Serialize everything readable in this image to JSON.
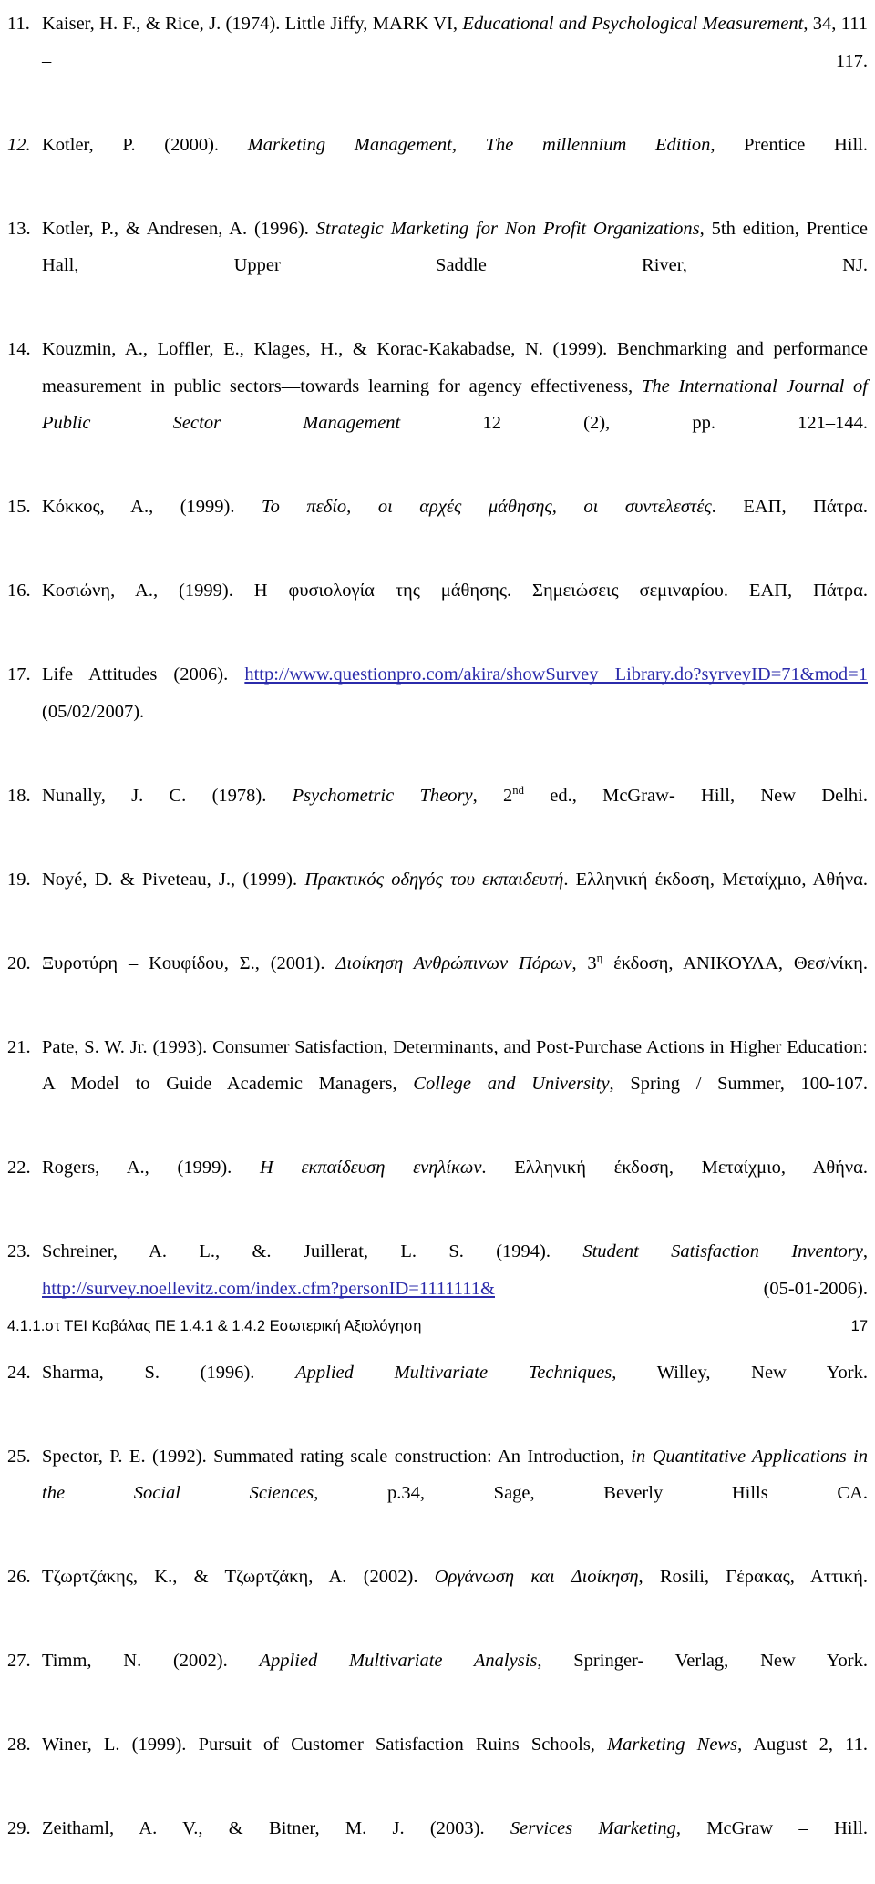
{
  "document": {
    "type": "reference-list",
    "page_number": "17",
    "footer_note": "4.1.1.στ ΤΕΙ Καβάλας ΠΕ 1.4.1 & 1.4.2 Εσωτερική Αξιολόγηση",
    "link_color": "#2b2bab",
    "text_color": "#000000",
    "background_color": "#ffffff"
  },
  "references": [
    {
      "number": "11.",
      "parts": [
        {
          "text": "Kaiser, H. F., & Rice, J. (1974). Little Jiffy, MARK VI, ",
          "style": "normal"
        },
        {
          "text": "Educational and Psychological Measurement",
          "style": "italic"
        },
        {
          "text": ", 34, 111 – 117.",
          "style": "normal"
        }
      ]
    },
    {
      "number": "12.",
      "number_style": "italic",
      "parts": [
        {
          "text": "Kotler, P. (2000). ",
          "style": "normal"
        },
        {
          "text": "Marketing Management, The millennium Edition",
          "style": "italic"
        },
        {
          "text": ", Prentice Hill.",
          "style": "normal"
        }
      ]
    },
    {
      "number": "13.",
      "parts": [
        {
          "text": "Kotler, P., & Andresen, A. (1996). ",
          "style": "normal"
        },
        {
          "text": "Strategic Marketing for Non Profit Organizations",
          "style": "italic"
        },
        {
          "text": ", 5th edition, Prentice Hall, Upper Saddle River, NJ.",
          "style": "normal"
        }
      ]
    },
    {
      "number": "14.",
      "parts": [
        {
          "text": "Kouzmin, A., Loffler, E., Klages, H., & Korac-Kakabadse, N. (1999). Benchmarking and performance measurement in public sectors—towards learning for agency effectiveness, ",
          "style": "normal"
        },
        {
          "text": "The International Journal of Public Sector Management",
          "style": "italic"
        },
        {
          "text": " 12 (2), pp. 121–144.",
          "style": "normal"
        }
      ]
    },
    {
      "number": "15.",
      "parts": [
        {
          "text": "Κόκκος, Α., (1999). ",
          "style": "normal"
        },
        {
          "text": "Το πεδίο, οι αρχές μάθησης, οι συντελεστές",
          "style": "italic"
        },
        {
          "text": ". ΕΑΠ, Πάτρα.",
          "style": "normal"
        }
      ]
    },
    {
      "number": "16.",
      "parts": [
        {
          "text": "Κοσιώνη, Α., (1999). Η φυσιολογία της μάθησης. Σημειώσεις σεμιναρίου. ΕΑΠ, Πάτρα.",
          "style": "normal"
        }
      ]
    },
    {
      "number": "17.",
      "parts": [
        {
          "text": "Life Attitudes (2006). ",
          "style": "normal"
        },
        {
          "text": "http://www.questionpro.com/akira/showSurvey Library.do?syrveyID=71&mod=1",
          "style": "link"
        },
        {
          "text": " (05/02/2007).",
          "style": "normal"
        }
      ]
    },
    {
      "number": "18.",
      "parts": [
        {
          "text": "Nunally, J. C. (1978). ",
          "style": "normal"
        },
        {
          "text": "Psychometric Theory",
          "style": "italic"
        },
        {
          "text": ", 2",
          "style": "normal"
        },
        {
          "text": "nd",
          "style": "superscript"
        },
        {
          "text": " ed., McGraw- Hill, New Delhi.",
          "style": "normal"
        }
      ]
    },
    {
      "number": "19.",
      "parts": [
        {
          "text": "Noyé, D. &  Piveteau, J., (1999). ",
          "style": "normal"
        },
        {
          "text": "Πρακτικός οδηγός του εκπαιδευτή",
          "style": "italic"
        },
        {
          "text": ". Ελληνική έκδοση, Μεταίχμιο, Αθήνα.",
          "style": "normal"
        }
      ]
    },
    {
      "number": "20.",
      "parts": [
        {
          "text": "Ξυροτύρη – Κουφίδου, Σ., (2001). ",
          "style": "normal"
        },
        {
          "text": "Διοίκηση Ανθρώπινων Πόρων",
          "style": "italic"
        },
        {
          "text": ", 3",
          "style": "normal"
        },
        {
          "text": "η",
          "style": "superscript"
        },
        {
          "text": " έκδοση, ΑΝΙΚΟΥΛΑ, Θεσ/νίκη.",
          "style": "normal"
        }
      ]
    },
    {
      "number": "21.",
      "parts": [
        {
          "text": "Pate, S. W. Jr. (1993). Consumer Satisfaction, Determinants, and Post-Purchase Actions in Higher Education: A Model to Guide Academic Managers, ",
          "style": "normal"
        },
        {
          "text": "College and University",
          "style": "italic"
        },
        {
          "text": ", Spring / Summer, 100-107.",
          "style": "normal"
        }
      ]
    },
    {
      "number": "22.",
      "parts": [
        {
          "text": "Rogers, A., (1999). ",
          "style": "normal"
        },
        {
          "text": "Η εκπαίδευση ενηλίκων",
          "style": "italic"
        },
        {
          "text": ". Ελληνική έκδοση, Μεταίχμιο, Αθήνα.",
          "style": "normal"
        }
      ]
    },
    {
      "number": "23.",
      "parts": [
        {
          "text": "Schreiner, A. L., &. Juillerat, L. S. (1994). ",
          "style": "normal"
        },
        {
          "text": "Student Satisfaction Inventory",
          "style": "italic"
        },
        {
          "text": ", ",
          "style": "normal"
        },
        {
          "text": "http://survey.noellevitz.com/index.cfm?personID=1111111&",
          "style": "link"
        },
        {
          "text": " (05-01-2006).",
          "style": "normal"
        }
      ]
    },
    {
      "number": "24.",
      "parts": [
        {
          "text": "Sharma, S. (1996). ",
          "style": "normal"
        },
        {
          "text": "Applied Multivariate Techniques",
          "style": "italic"
        },
        {
          "text": ", Willey, New York.",
          "style": "normal"
        }
      ]
    },
    {
      "number": "25.",
      "parts": [
        {
          "text": "Spector, P. E. (1992). Summated rating scale construction: An Introduction, ",
          "style": "normal"
        },
        {
          "text": "in Quantitative Applications in the Social Sciences",
          "style": "italic"
        },
        {
          "text": ", p.34, Sage, Beverly Hills CA.",
          "style": "normal"
        }
      ]
    },
    {
      "number": "26.",
      "parts": [
        {
          "text": "Τζωρτζάκης, Κ., & Τζωρτζάκη, Α. (2002). ",
          "style": "normal"
        },
        {
          "text": "Οργάνωση και Διοίκηση",
          "style": "italic"
        },
        {
          "text": ", Rosili, Γέρακας, Αττική.",
          "style": "normal"
        }
      ]
    },
    {
      "number": "27.",
      "parts": [
        {
          "text": "Timm, N. (2002). ",
          "style": "normal"
        },
        {
          "text": "Applied Multivariate Analysis",
          "style": "italic"
        },
        {
          "text": ", Springer- Verlag, New York.",
          "style": "normal"
        }
      ]
    },
    {
      "number": "28.",
      "parts": [
        {
          "text": "Winer, L. (1999). Pursuit of Customer Satisfaction Ruins Schools, ",
          "style": "normal"
        },
        {
          "text": "Marketing News",
          "style": "italic"
        },
        {
          "text": ", August 2, 11.",
          "style": "normal"
        }
      ]
    },
    {
      "number": "29.",
      "parts": [
        {
          "text": "Zeithaml, A. V., & Bitner, M. J. (2003). ",
          "style": "normal"
        },
        {
          "text": "Services Marketing",
          "style": "italic"
        },
        {
          "text": ", McGraw – Hill.",
          "style": "normal"
        }
      ]
    }
  ]
}
